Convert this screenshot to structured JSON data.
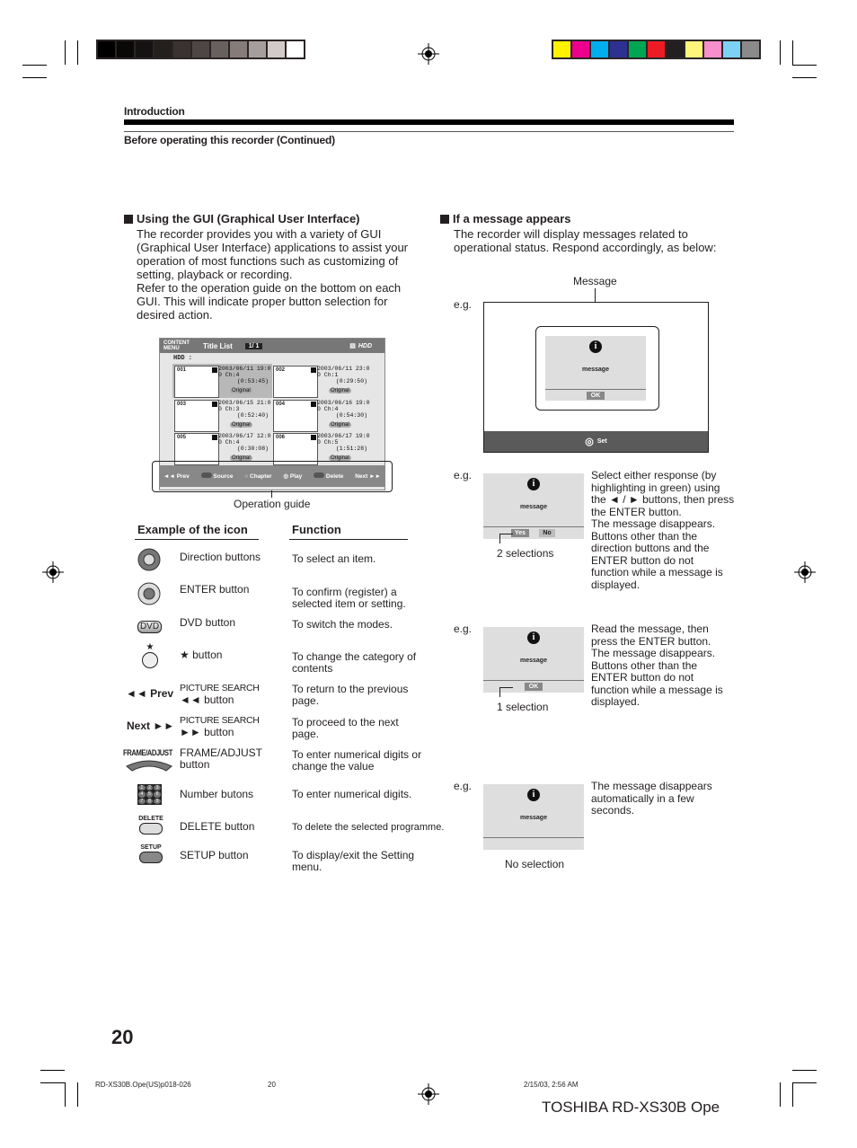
{
  "header": {
    "section": "Introduction",
    "subsection": "Before operating this recorder (Continued)"
  },
  "color_bars": {
    "grayscale": [
      "#000000",
      "#0a0806",
      "#151213",
      "#231f1d",
      "#3a3230",
      "#4e4644",
      "#68605d",
      "#857c7a",
      "#a69e9c",
      "#d3cbca",
      "#ffffff"
    ],
    "color": [
      "#fff100",
      "#ec008c",
      "#00aeef",
      "#2e3192",
      "#00a651",
      "#ed1c24",
      "#231f20",
      "#fff57a",
      "#f68fcb",
      "#7dd1f5",
      "#8a8a8a"
    ]
  },
  "gui_section": {
    "title": "Using the GUI (Graphical User Interface)",
    "paragraph1": [
      "The recorder provides you with a variety of GUI",
      "(Graphical User Interface) applications to assist your",
      "operation of most functions such as customizing of",
      "setting, playback or recording."
    ],
    "paragraph2": [
      "Refer to the operation guide on the bottom on each",
      "GUI. This will indicate proper button selection for",
      "desired action."
    ]
  },
  "title_list_gui": {
    "menu_label": "CONTENT MENU",
    "title": "Title List",
    "page": "1/ 1",
    "device_label": "HDD",
    "source_label": "HDD  :",
    "items": [
      {
        "num": "001",
        "date": "2003/06/11  19:0",
        "ch": "0 Ch:4",
        "duration": "(0:53:45)",
        "tag": "Original"
      },
      {
        "num": "002",
        "date": "2003/06/11  23:0",
        "ch": "0 Ch:1",
        "duration": "(0:29:50)",
        "tag": "Original"
      },
      {
        "num": "003",
        "date": "2003/06/15  21:0",
        "ch": "0 Ch:3",
        "duration": "(0:52:40)",
        "tag": "Original"
      },
      {
        "num": "004",
        "date": "2003/06/16  19:0",
        "ch": "0 Ch:4",
        "duration": "(0:54:30)",
        "tag": "Original"
      },
      {
        "num": "005",
        "date": "2003/06/17  12:0",
        "ch": "0 Ch:4",
        "duration": "(0:30:08)",
        "tag": "Original"
      },
      {
        "num": "006",
        "date": "2003/06/17 19:0",
        "ch": "0 Ch:5",
        "duration": "(1:51:28)",
        "tag": "Original"
      }
    ],
    "guide": {
      "prev": "Prev",
      "source": "Source",
      "chapter": "Chapter",
      "play": "Play",
      "delete": "Delete",
      "next": "Next"
    },
    "caption": "Operation guide"
  },
  "icon_table": {
    "col1_header": "Example of the icon",
    "col2_header": "Function",
    "rows": [
      {
        "icon": "direction-pad-icon",
        "icon_text": "",
        "label": "Direction buttons",
        "label2": "",
        "function": "To select an item.",
        "function2": ""
      },
      {
        "icon": "enter-pad-icon",
        "icon_text": "",
        "label": "ENTER button",
        "label2": "",
        "function": "To confirm (register)  a",
        "function2": "selected item or setting."
      },
      {
        "icon": "dvd-button-icon",
        "icon_text": "DVD",
        "label": "DVD button",
        "label2": "",
        "function": "To switch the modes.",
        "function2": ""
      },
      {
        "icon": "star-button-icon",
        "icon_text": "★",
        "label": "★ button",
        "label2": "",
        "function": "To change the category of",
        "function2": "contents"
      },
      {
        "icon": "prev-icon",
        "icon_text": "◄◄ Prev",
        "label": "PICTURE SEARCH",
        "label2": "◄◄ button",
        "function": "To return to the previous",
        "function2": "page."
      },
      {
        "icon": "next-icon",
        "icon_text": "Next ►►",
        "label": "PICTURE SEARCH",
        "label2": "►► button",
        "function": "To proceed to the next",
        "function2": "page."
      },
      {
        "icon": "frame-adjust-icon",
        "icon_text": "FRAME/ADJUST",
        "label": "FRAME/ADJUST",
        "label2": "button",
        "function": "To enter numerical digits or",
        "function2": "change the value"
      },
      {
        "icon": "number-buttons-icon",
        "icon_text": "",
        "label": "Number butons",
        "label2": "",
        "function": "To enter numerical digits.",
        "function2": ""
      },
      {
        "icon": "delete-button-icon",
        "icon_text": "DELETE",
        "label": "DELETE button",
        "label2": "",
        "function": "To delete the selected programme.",
        "function2": ""
      },
      {
        "icon": "setup-button-icon",
        "icon_text": "SETUP",
        "label": "SETUP button",
        "label2": "",
        "function": "To display/exit the Setting",
        "function2": "menu."
      }
    ],
    "number_keys": [
      "1",
      "2",
      "3",
      "4",
      "5",
      "6",
      "7",
      "8",
      "9"
    ]
  },
  "message_section": {
    "title": "If a message appears",
    "paragraph": [
      "The recorder will display messages related to",
      "operational status. Respond accordingly, as below:"
    ],
    "eg": "e.g.",
    "callout": "Message",
    "screen": {
      "message": "message",
      "ok": "OK",
      "set": "Set"
    },
    "examples": [
      {
        "message": "message",
        "buttons": [
          "Yes",
          "No"
        ],
        "caption": "2 selections",
        "description": [
          "Select either response (by",
          "highlighting in green) using",
          "the ◄ / ► buttons, then press",
          "the ENTER button.",
          "The message disappears.",
          "Buttons other than the",
          "direction buttons and the",
          "ENTER button do not",
          "function while a message is",
          "displayed."
        ]
      },
      {
        "message": "message",
        "buttons": [
          "OK"
        ],
        "caption": "1 selection",
        "description": [
          "Read the message, then",
          "press the ENTER button.",
          "The message disappears.",
          "Buttons other than the",
          "ENTER button do not",
          "function while a message is",
          "displayed."
        ]
      },
      {
        "message": "message",
        "buttons": [],
        "caption": "No selection",
        "description": [
          "The message disappears",
          "automatically in a few",
          "seconds."
        ]
      }
    ]
  },
  "footer": {
    "page_number": "20",
    "file_name": "RD-XS30B.Ope(US)p018-026",
    "file_page": "20",
    "timestamp": "2/15/03, 2:56 AM",
    "brand": "TOSHIBA RD-XS30B Ope"
  }
}
